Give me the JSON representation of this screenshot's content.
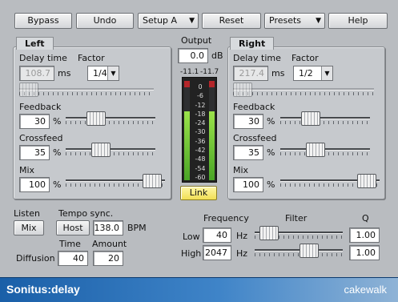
{
  "toolbar": {
    "bypass": "Bypass",
    "undo": "Undo",
    "setup": "Setup A",
    "reset": "Reset",
    "presets": "Presets",
    "help": "Help"
  },
  "left": {
    "title": "Left",
    "delay_time_label": "Delay time",
    "delay_time_value": "108.7",
    "delay_time_unit": "ms",
    "factor_label": "Factor",
    "factor_value": "1/4",
    "feedback_label": "Feedback",
    "feedback_value": "30",
    "crossfeed_label": "Crossfeed",
    "crossfeed_value": "35",
    "mix_label": "Mix",
    "mix_value": "100",
    "percent": "%"
  },
  "right": {
    "title": "Right",
    "delay_time_label": "Delay time",
    "delay_time_value": "217.4",
    "delay_time_unit": "ms",
    "factor_label": "Factor",
    "factor_value": "1/2",
    "feedback_label": "Feedback",
    "feedback_value": "30",
    "crossfeed_label": "Crossfeed",
    "crossfeed_value": "35",
    "mix_label": "Mix",
    "mix_value": "100",
    "percent": "%"
  },
  "output": {
    "label": "Output",
    "value": "0.0",
    "unit": "dB",
    "peak_left": "-11.1",
    "peak_right": "-11.7",
    "scale": [
      "0",
      "-6",
      "-12",
      "-18",
      "-24",
      "-30",
      "-36",
      "-42",
      "-48",
      "-54",
      "-60"
    ],
    "link": "Link"
  },
  "bottom": {
    "listen_label": "Listen",
    "listen_value": "Mix",
    "tempo_label": "Tempo sync.",
    "tempo_host": "Host",
    "tempo_value": "138.0",
    "tempo_unit": "BPM",
    "diffusion_label": "Diffusion",
    "time_label": "Time",
    "time_value": "40",
    "amount_label": "Amount",
    "amount_value": "20"
  },
  "filter": {
    "frequency_label": "Frequency",
    "filter_label": "Filter",
    "q_label": "Q",
    "low_label": "Low",
    "low_value": "40",
    "high_label": "High",
    "high_value": "2047",
    "hz": "Hz",
    "low_q": "1.00",
    "high_q": "1.00"
  },
  "footer": {
    "product": "Sonitus:delay",
    "brand": "cakewalk"
  }
}
